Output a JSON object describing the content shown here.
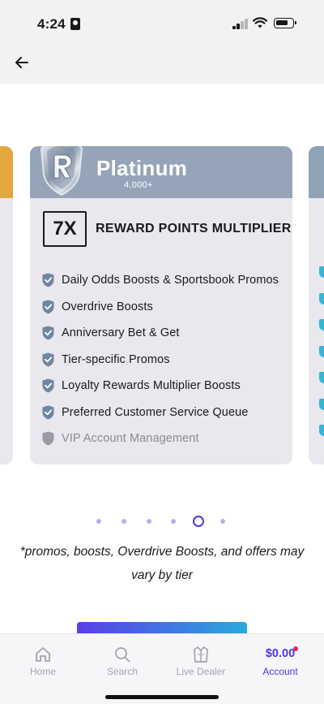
{
  "status_bar": {
    "time": "4:24"
  },
  "card": {
    "tier_name": "Platinum",
    "tier_points": "4,000+",
    "multiplier_value": "7X",
    "multiplier_label": "REWARD POINTS MULTIPLIER",
    "benefits": [
      {
        "label": "Daily Odds Boosts & Sportsbook Promos",
        "included": true
      },
      {
        "label": "Overdrive Boosts",
        "included": true
      },
      {
        "label": "Anniversary Bet & Get",
        "included": true
      },
      {
        "label": "Tier-specific Promos",
        "included": true
      },
      {
        "label": "Loyalty Rewards Multiplier Boosts",
        "included": true
      },
      {
        "label": "Preferred Customer Service Queue",
        "included": true
      },
      {
        "label": "VIP Account Management",
        "included": false
      }
    ]
  },
  "pager": {
    "total": 6,
    "active_index": 4
  },
  "disclaimer": "*promos, boosts, Overdrive Boosts, and offers may vary by tier",
  "tab_bar": {
    "home": "Home",
    "search": "Search",
    "live_dealer": "Live Dealer",
    "balance": "$0.00",
    "account": "Account"
  },
  "colors": {
    "accent": "#4E36E9",
    "platinum_header": "#95A4B8",
    "gold_tier": "#E2A73D",
    "diamond_tier_check": "#35B6D3",
    "card_background": "#E9E8EE"
  }
}
